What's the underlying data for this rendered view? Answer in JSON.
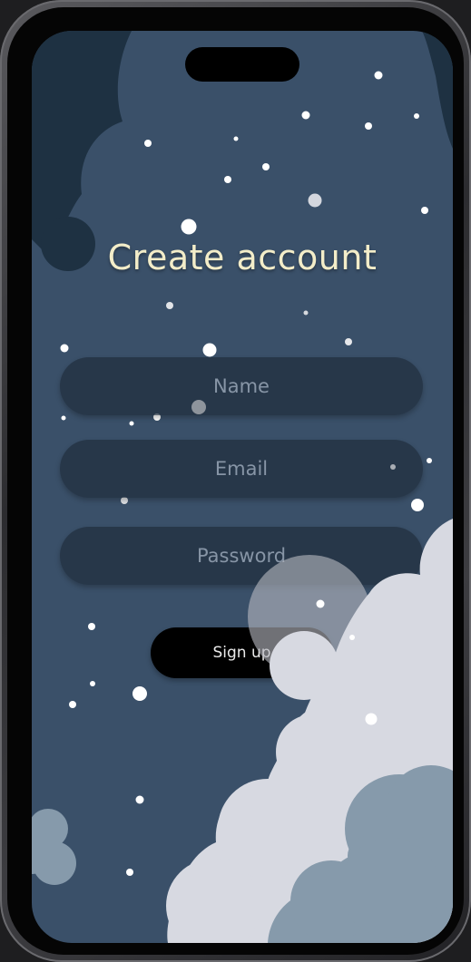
{
  "form": {
    "title": "Create account",
    "name_placeholder": "Name",
    "email_placeholder": "Email",
    "password_placeholder": "Password",
    "signup_label": "Sign up"
  },
  "theme": {
    "background": "#3a5069",
    "field_background": "#26384a",
    "title_color": "#f3edc9",
    "cloud_light": "#d7d9e1",
    "cloud_dark": "#869aab",
    "button": "#000000"
  }
}
